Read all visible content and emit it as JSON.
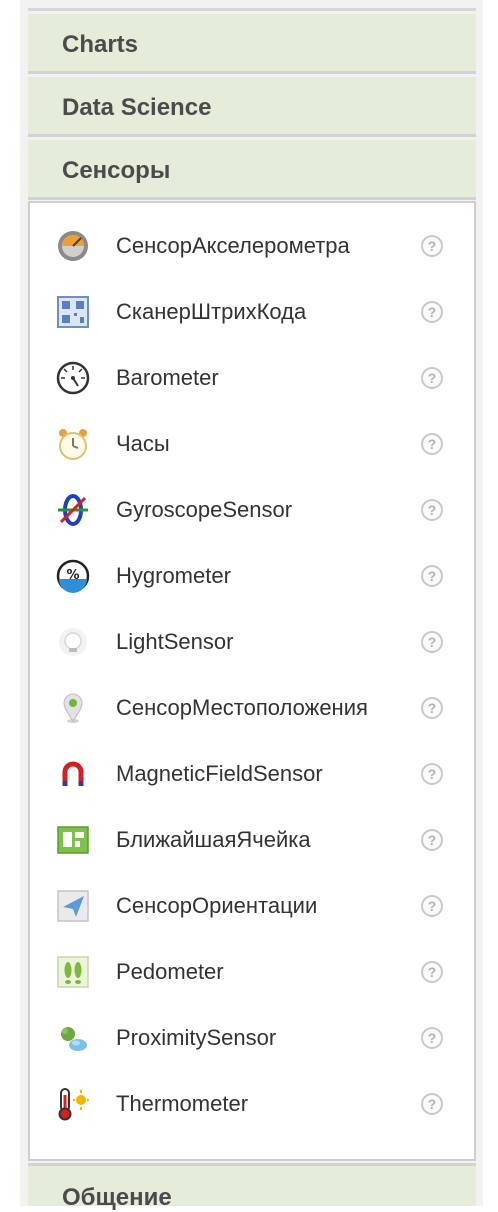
{
  "categories": {
    "charts": "Charts",
    "data_science": "Data Science",
    "sensors": "Сенсоры",
    "communication": "Общение"
  },
  "sensors": [
    {
      "label": "СенсорАкселерометра",
      "icon": "accelerometer-icon"
    },
    {
      "label": "СканерШтрихКода",
      "icon": "barcode-scanner-icon"
    },
    {
      "label": "Barometer",
      "icon": "barometer-icon"
    },
    {
      "label": "Часы",
      "icon": "clock-icon"
    },
    {
      "label": "GyroscopeSensor",
      "icon": "gyroscope-icon"
    },
    {
      "label": "Hygrometer",
      "icon": "hygrometer-icon"
    },
    {
      "label": "LightSensor",
      "icon": "light-sensor-icon"
    },
    {
      "label": "СенсорМестоположения",
      "icon": "location-pin-icon"
    },
    {
      "label": "MagneticFieldSensor",
      "icon": "magnet-icon"
    },
    {
      "label": "БлижайшаяЯчейка",
      "icon": "nearfield-icon"
    },
    {
      "label": "СенсорОриентации",
      "icon": "orientation-icon"
    },
    {
      "label": "Pedometer",
      "icon": "pedometer-icon"
    },
    {
      "label": "ProximitySensor",
      "icon": "proximity-icon"
    },
    {
      "label": "Thermometer",
      "icon": "thermometer-icon"
    }
  ],
  "help_glyph": "?"
}
